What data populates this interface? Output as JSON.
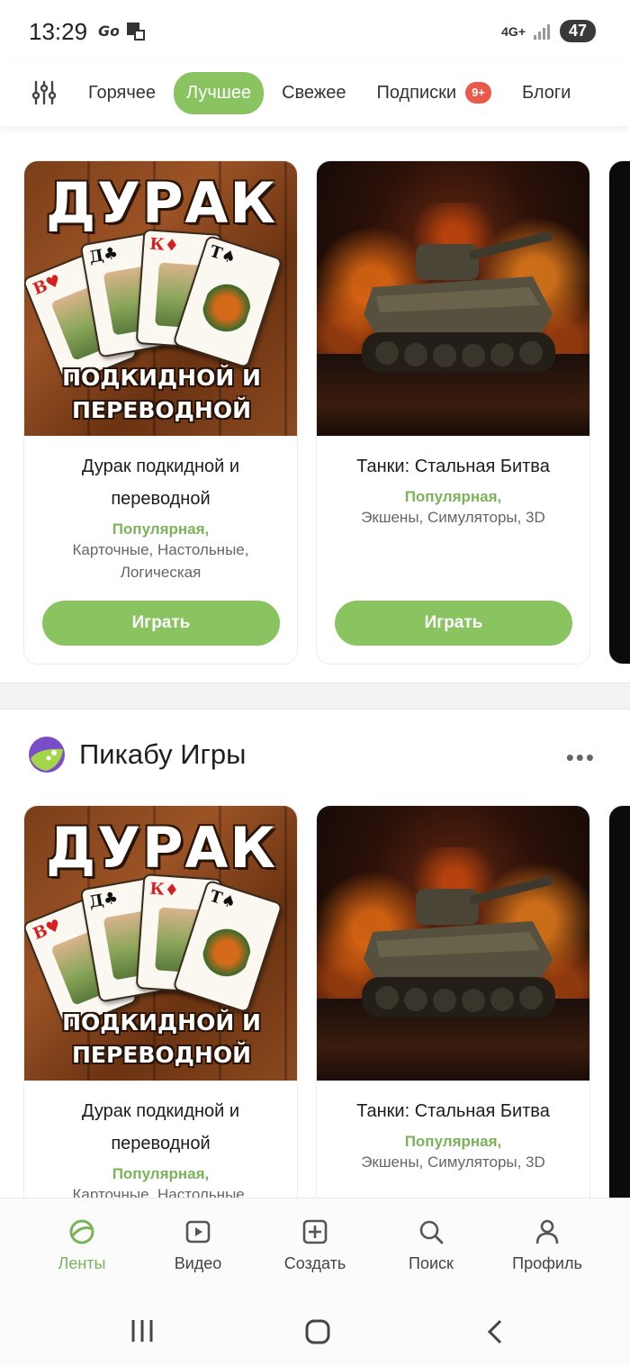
{
  "status": {
    "time": "13:29",
    "network": "4G+",
    "battery": "47"
  },
  "topnav": {
    "tabs": [
      {
        "label": "Горячее"
      },
      {
        "label": "Лучшее"
      },
      {
        "label": "Свежее"
      },
      {
        "label": "Подписки",
        "badge": "9+"
      },
      {
        "label": "Блоги"
      }
    ],
    "active_tab": 1
  },
  "section1": {
    "cards": [
      {
        "title": "Дурак подкидной и переводной",
        "tag": "Популярная,",
        "genres": "Карточные, Настольные, Логическая",
        "button": "Играть",
        "art": {
          "big": "ДУРАК",
          "line1": "ПОДКИДНОЙ И",
          "line2": "ПЕРЕВОДНОЙ"
        }
      },
      {
        "title": "Танки: Стальная Битва",
        "tag": "Популярная,",
        "genres": "Экшены, Симуляторы, 3D",
        "button": "Играть"
      }
    ]
  },
  "section2": {
    "title": "Пикабу Игры",
    "more": "•••",
    "cards": [
      {
        "title": "Дурак подкидной и переводной",
        "tag": "Популярная,",
        "genres": "Карточные, Настольные, Логическая",
        "art": {
          "big": "ДУРАК",
          "line1": "ПОДКИДНОЙ И",
          "line2": "ПЕРЕВОДНОЙ"
        }
      },
      {
        "title": "Танки: Стальная Битва",
        "tag": "Популярная,",
        "genres": "Экшены, Симуляторы, 3D"
      }
    ]
  },
  "bottomnav": {
    "items": [
      {
        "label": "Ленты",
        "icon": "feeds-icon"
      },
      {
        "label": "Видео",
        "icon": "video-icon"
      },
      {
        "label": "Создать",
        "icon": "create-icon"
      },
      {
        "label": "Поиск",
        "icon": "search-icon"
      },
      {
        "label": "Профиль",
        "icon": "profile-icon"
      }
    ]
  },
  "colors": {
    "accent": "#8ac461",
    "badge": "#e9594c",
    "tag": "#7ab35a"
  }
}
